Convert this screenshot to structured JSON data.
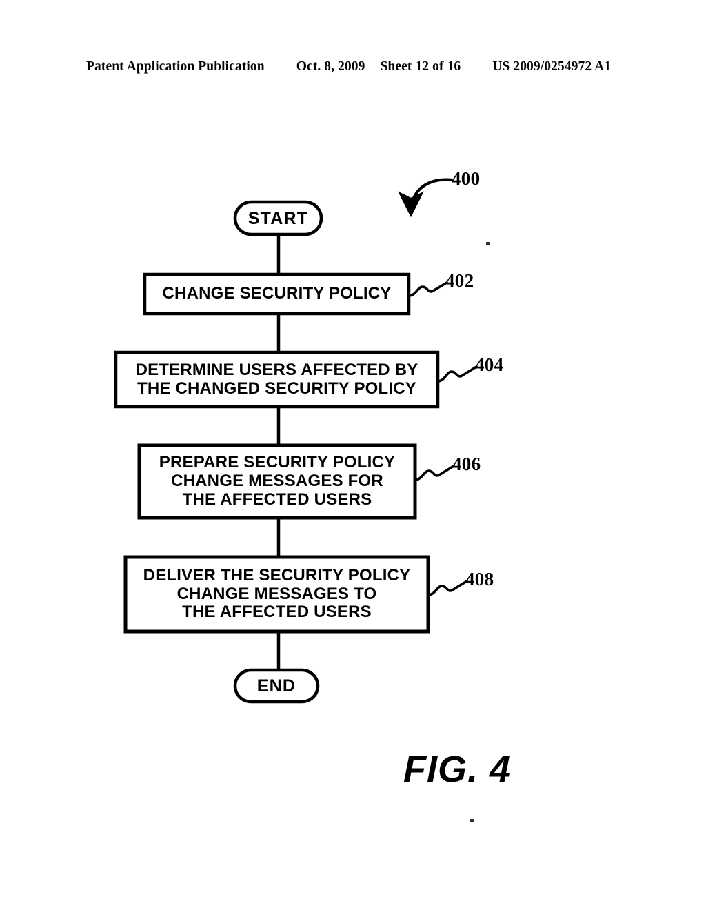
{
  "header": {
    "publication": "Patent Application Publication",
    "date": "Oct. 8, 2009",
    "sheet": "Sheet 12 of 16",
    "patent_number": "US 2009/0254972 A1"
  },
  "figure": {
    "label": "FIG. 4",
    "diagram_reference": "400"
  },
  "flowchart": {
    "nodes": [
      {
        "id": "start",
        "shape": "terminal",
        "lines": [
          "START"
        ],
        "ref": null
      },
      {
        "id": "step-402",
        "shape": "process",
        "lines": [
          "CHANGE SECURITY POLICY"
        ],
        "ref": "402"
      },
      {
        "id": "step-404",
        "shape": "process",
        "lines": [
          "DETERMINE USERS AFFECTED BY",
          "THE CHANGED SECURITY POLICY"
        ],
        "ref": "404"
      },
      {
        "id": "step-406",
        "shape": "process",
        "lines": [
          "PREPARE SECURITY POLICY",
          "CHANGE MESSAGES FOR",
          "THE AFFECTED USERS"
        ],
        "ref": "406"
      },
      {
        "id": "step-408",
        "shape": "process",
        "lines": [
          "DELIVER THE SECURITY POLICY",
          "CHANGE MESSAGES TO",
          "THE AFFECTED USERS"
        ],
        "ref": "408"
      },
      {
        "id": "end",
        "shape": "terminal",
        "lines": [
          "END"
        ],
        "ref": null
      }
    ]
  },
  "colors": {
    "ink": "#000000",
    "paper": "#ffffff"
  }
}
